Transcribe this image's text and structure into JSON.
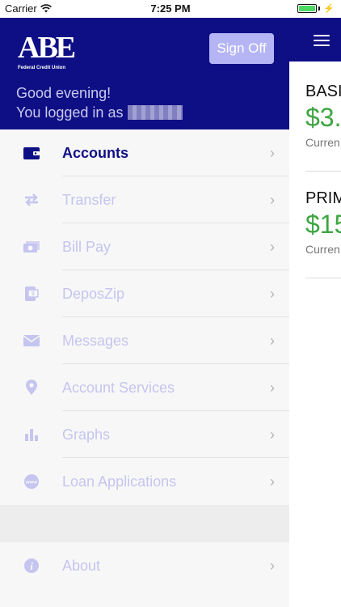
{
  "status_bar": {
    "carrier": "Carrier",
    "time": "7:25 PM"
  },
  "drawer": {
    "logo": {
      "letters": "ABE",
      "subtitle": "Federal Credit Union"
    },
    "sign_off": "Sign Off",
    "greeting": "Good evening!",
    "login_prefix": "You logged in as",
    "items": [
      {
        "label": "Accounts",
        "icon": "wallet-icon"
      },
      {
        "label": "Transfer",
        "icon": "transfer-arrows-icon"
      },
      {
        "label": "Bill Pay",
        "icon": "bill-pay-icon"
      },
      {
        "label": "DeposZip",
        "icon": "deposit-phone-icon"
      },
      {
        "label": "Messages",
        "icon": "envelope-icon"
      },
      {
        "label": "Account Services",
        "icon": "location-pin-icon"
      },
      {
        "label": "Graphs",
        "icon": "bar-graph-icon"
      },
      {
        "label": "Loan Applications",
        "icon": "www-icon"
      }
    ],
    "about": {
      "label": "About",
      "icon": "info-icon"
    }
  },
  "main": {
    "accounts": [
      {
        "name": "BASI",
        "amount": "$3.",
        "sub": "Curren"
      },
      {
        "name": "PRIM",
        "amount": "$15",
        "sub": "Curren"
      }
    ]
  },
  "colors": {
    "brand": "#0f0f85",
    "inactive": "#c5c5ef",
    "positive": "#3ea542",
    "signoff_bg": "#b5b5f5"
  }
}
